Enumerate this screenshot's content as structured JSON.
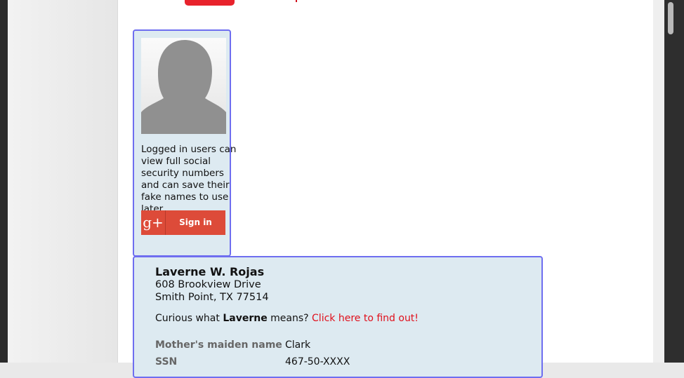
{
  "login_panel": {
    "message": "Logged in users can view full social security numbers and can save their fake names to use later.",
    "google_signin": {
      "icon": "g+",
      "label": "Sign in"
    }
  },
  "identity": {
    "name": "Laverne W. Rojas",
    "address_line1": "608 Brookview Drive",
    "address_line2": "Smith Point, TX 77514",
    "curious_prefix": "Curious what",
    "first_name": "Laverne",
    "curious_suffix": "means?",
    "link_text": "Click here to find out!",
    "fields": [
      {
        "label": "Mother's maiden name",
        "value": "Clark"
      },
      {
        "label": "SSN",
        "value": "467-50-XXXX"
      }
    ]
  },
  "colors": {
    "accent_red": "#e0101c",
    "box_bg": "#ddeaf1",
    "box_border": "#6e6ef0",
    "google_red": "#dd4b39"
  }
}
